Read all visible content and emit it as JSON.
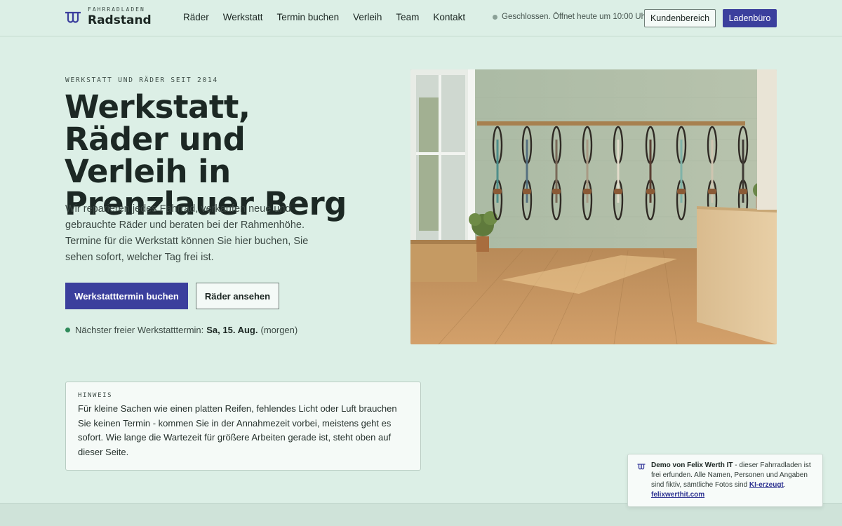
{
  "brand": {
    "kicker": "FAHRRADLADEN",
    "name": "Radstand"
  },
  "nav": {
    "items": [
      "Räder",
      "Werkstatt",
      "Termin buchen",
      "Verleih",
      "Team",
      "Kontakt"
    ]
  },
  "header": {
    "status": "Geschlossen. Öffnet heute um 10:00 Uhr",
    "customer_area": "Kundenbereich",
    "shop_office": "Ladenbüro"
  },
  "hero": {
    "eyebrow": "WERKSTATT UND RÄDER SEIT 2014",
    "headline": "Werkstatt, Räder und Verleih in Prenzlauer Berg",
    "lede": "Wir reparieren jedes Fahrrad, verkaufen neue und gebrauchte Räder und beraten bei der Rahmenhöhe. Termine für die Werkstatt können Sie hier buchen, Sie sehen sofort, welcher Tag frei ist.",
    "primary_cta": "Werkstatttermin buchen",
    "secondary_cta": "Räder ansehen",
    "next_slot_prefix": "Nächster freier Werkstatttermin:",
    "next_slot_date": "Sa, 15. Aug.",
    "next_slot_suffix": "(morgen)"
  },
  "notice": {
    "label": "HINWEIS",
    "text": "Für kleine Sachen wie einen platten Reifen, fehlendes Licht oder Luft brauchen Sie keinen Termin - kommen Sie in der Annahmezeit vorbei, meistens geht es sofort. Wie lange die Wartezeit für größere Arbeiten gerade ist, steht oben auf dieser Seite."
  },
  "demo": {
    "author": "Demo von Felix Werth IT",
    "text": " - dieser Fahrradladen ist frei erfunden. Alle Namen, Personen und Angaben sind fiktiv, sämtliche Fotos sind ",
    "ai_link": "KI-erzeugt",
    "end": ".",
    "site_link": "felixwerthit.com"
  },
  "colors": {
    "background": "#dcefe6",
    "accent": "#3b3f9d",
    "status_open_dot": "#2f8a5a",
    "status_closed_dot": "#8aa096"
  },
  "icons": {
    "logo": "radstand-logo-icon",
    "demo": "radstand-logo-icon"
  }
}
